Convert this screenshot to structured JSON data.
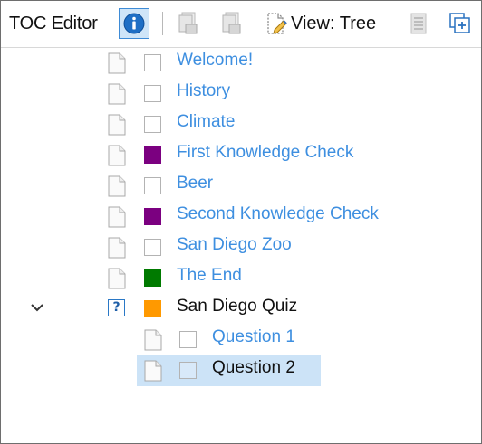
{
  "toolbar": {
    "title": "TOC Editor",
    "view_label": "View: Tree"
  },
  "tree": {
    "items": [
      {
        "label": "Welcome!",
        "swatch": null,
        "style": "link"
      },
      {
        "label": "History",
        "swatch": null,
        "style": "link"
      },
      {
        "label": "Climate",
        "swatch": null,
        "style": "link"
      },
      {
        "label": "First Knowledge Check",
        "swatch": "#7b0080",
        "style": "link"
      },
      {
        "label": "Beer",
        "swatch": null,
        "style": "link"
      },
      {
        "label": "Second Knowledge Check",
        "swatch": "#7b0080",
        "style": "link"
      },
      {
        "label": "San Diego Zoo",
        "swatch": null,
        "style": "link"
      },
      {
        "label": "The End",
        "swatch": "#007a00",
        "style": "link"
      },
      {
        "label": "San Diego Quiz",
        "swatch": "#ff9900",
        "style": "plain",
        "expanded": true,
        "icon": "question-icon",
        "icon_text": "?"
      },
      {
        "label": "Question 1",
        "swatch": null,
        "style": "link",
        "level": 1
      },
      {
        "label": "Question 2",
        "swatch": null,
        "style": "plain",
        "level": 1,
        "selected": true
      }
    ]
  },
  "colors": {
    "link": "#3e8fe0",
    "selection": "#cce3f7",
    "accent": "#1f6fc5"
  }
}
